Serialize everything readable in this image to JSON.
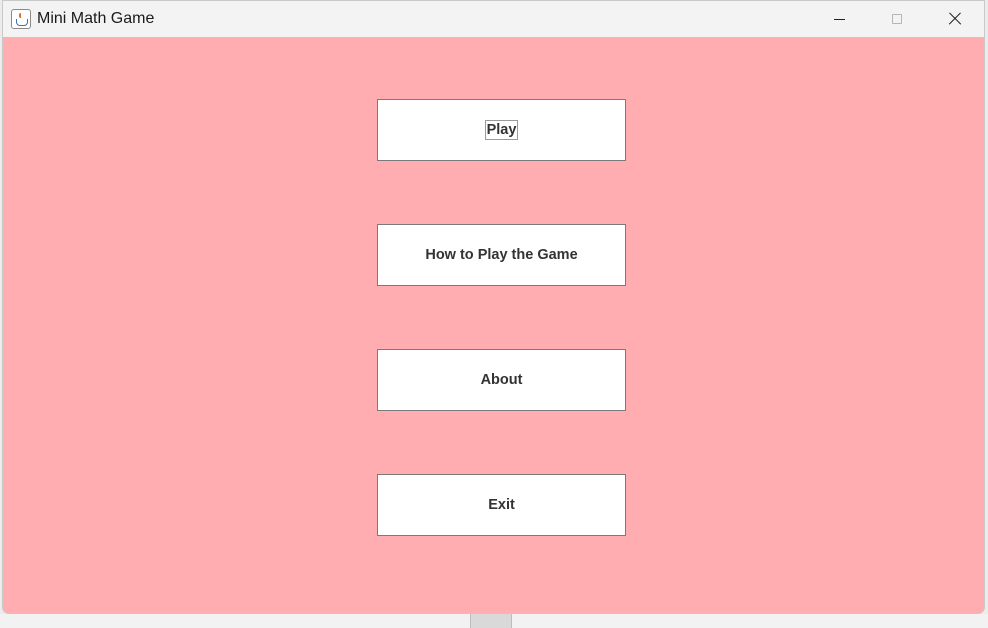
{
  "window": {
    "title": "Mini Math Game",
    "background_color": "#ffadb0",
    "icon": "java-app-icon"
  },
  "title_controls": {
    "minimize_icon": "minimize-icon",
    "maximize_icon": "maximize-icon",
    "close_icon": "close-icon"
  },
  "menu": {
    "play_label": "Play",
    "howto_label": "How to Play the Game",
    "about_label": "About",
    "exit_label": "Exit",
    "focused": "Play"
  }
}
